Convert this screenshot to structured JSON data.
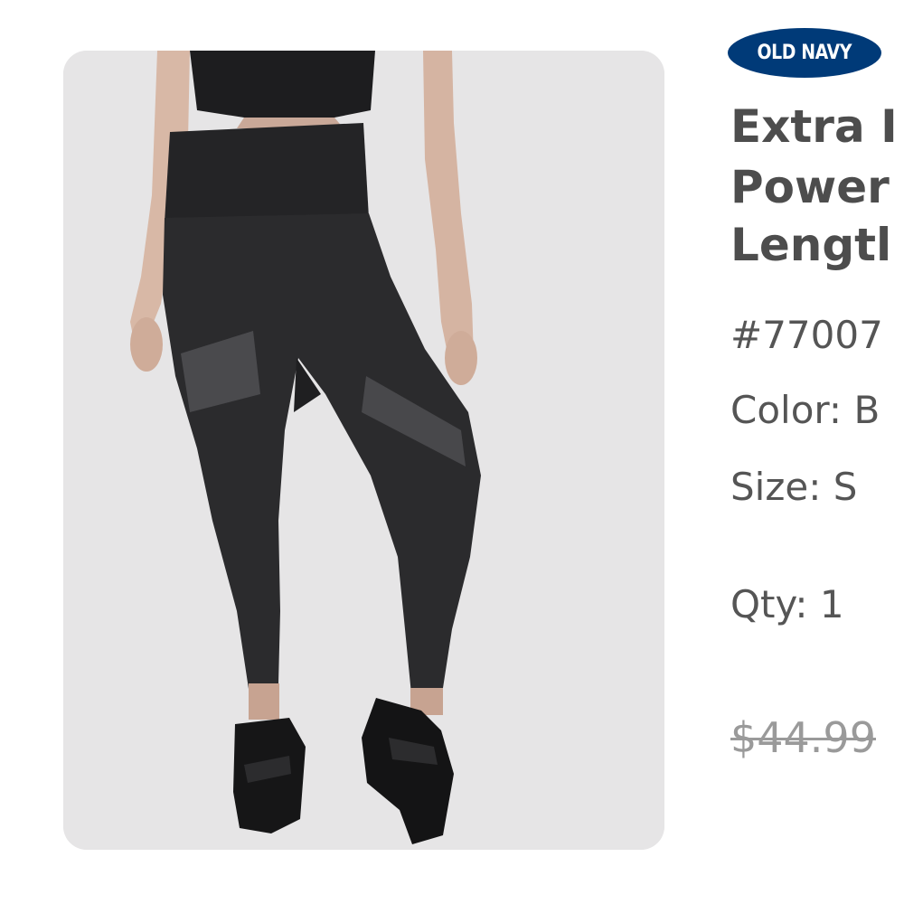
{
  "brand": {
    "logo_text": "OLD NAVY",
    "logo_color": "#003a78"
  },
  "product": {
    "title_lines": [
      "Extra I",
      "Power",
      "Lengtl"
    ],
    "item_number": "#77007",
    "color_label": "Color:",
    "color_value": "B",
    "size_label": "Size:",
    "size_value": "S",
    "qty_label": "Qty:",
    "qty_value": "1",
    "original_price": "$44.99"
  },
  "image": {
    "subject": "black high-waisted leggings with sheer mesh panels and black sneakers",
    "background_color": "#e6e5e6"
  }
}
